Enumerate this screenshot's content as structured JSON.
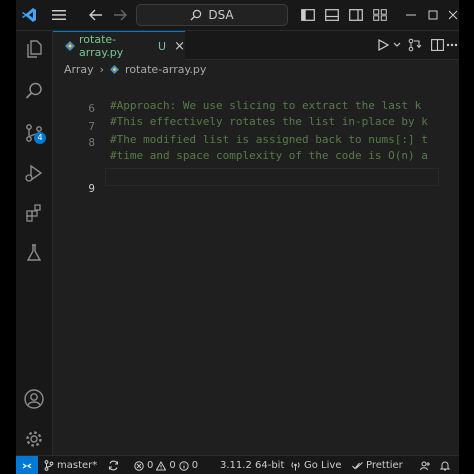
{
  "title_bar": {
    "search_text": "DSA"
  },
  "activity_bar": {
    "source_control_badge": "4"
  },
  "tab": {
    "file_name": "rotate-array.py",
    "status": "U",
    "close_glyph": "×"
  },
  "breadcrumb": {
    "folder": "Array",
    "separator": "›",
    "file": "rotate-array.py"
  },
  "editor": {
    "lines": [
      {
        "number": "",
        "text": "#Approach: We use slicing to extract the last k"
      },
      {
        "number": "6",
        "text": "#This effectively rotates the list in-place by k"
      },
      {
        "number": "7",
        "text": "#The modified list is assigned back to nums[:] t"
      },
      {
        "number": "8",
        "text": "#time and space complexity of the code is O(n) a"
      },
      {
        "number": "",
        "text": ""
      },
      {
        "number": "",
        "text": ""
      },
      {
        "number": "9",
        "text": ""
      }
    ]
  },
  "status_bar": {
    "branch": "master*",
    "errors": "0",
    "warnings": "0",
    "info": "0",
    "python_version": "3.11.2 64-bit",
    "go_live": "Go Live",
    "prettier": "Prettier"
  },
  "colors": {
    "accent": "#0078d4",
    "untracked": "#73c991",
    "comment": "#6a9955"
  }
}
